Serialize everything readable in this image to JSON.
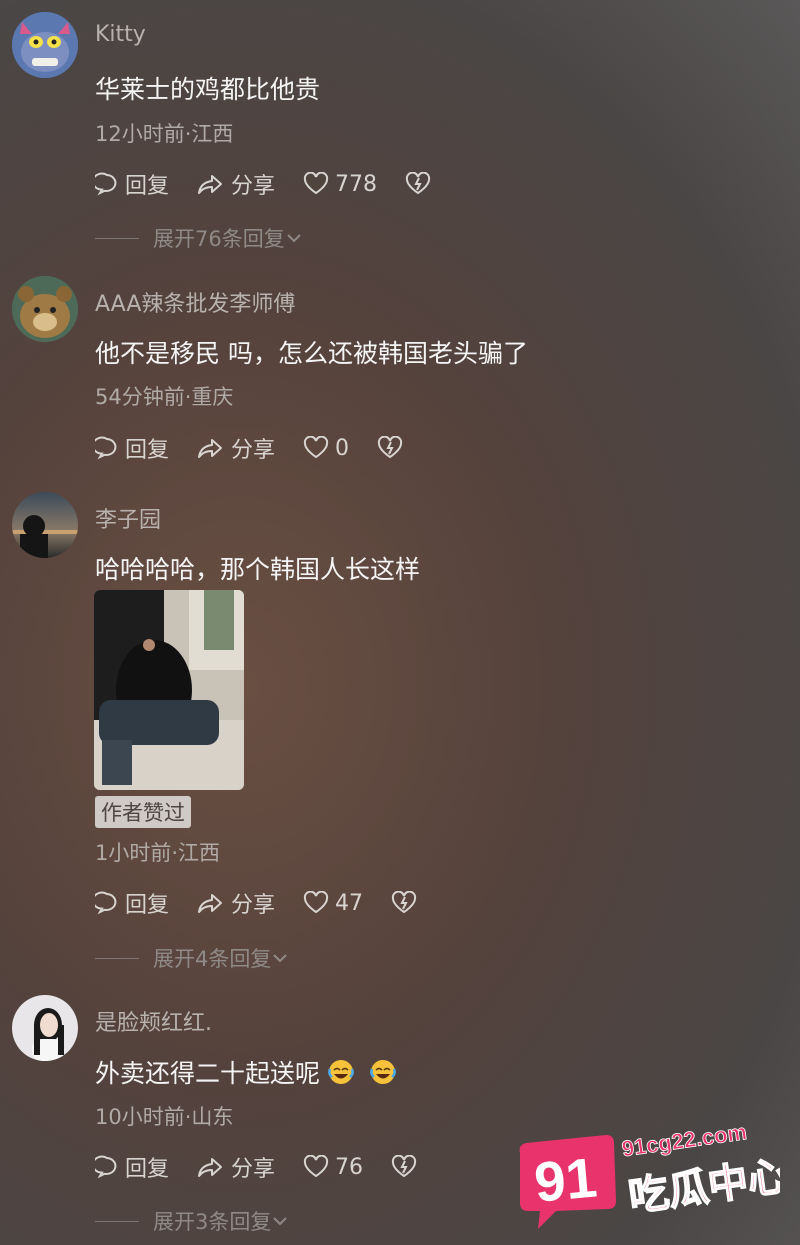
{
  "comments": [
    {
      "user": "Kitty",
      "text": "华莱士的鸡都比他贵",
      "meta": "12小时前·江西",
      "reply_label": "回复",
      "share_label": "分享",
      "likes": "778",
      "expand": "展开76条回复"
    },
    {
      "user": "AAA辣条批发李师傅",
      "text": "他不是移民 吗，怎么还被韩国老头骗了",
      "meta": "54分钟前·重庆",
      "reply_label": "回复",
      "share_label": "分享",
      "likes": "0"
    },
    {
      "user": "李子园",
      "text": "哈哈哈哈，那个韩国人长这样",
      "tag": "作者赞过",
      "meta": "1小时前·江西",
      "reply_label": "回复",
      "share_label": "分享",
      "likes": "47",
      "expand": "展开4条回复"
    },
    {
      "user": "是脸颊红红.",
      "text": "外卖还得二十起送呢",
      "meta": "10小时前·山东",
      "reply_label": "回复",
      "share_label": "分享",
      "likes": "76",
      "expand": "展开3条回复"
    }
  ],
  "watermark": {
    "number": "91",
    "domain": "91cg22.com",
    "slogan": "吃瓜中心",
    "color": "#e8336d"
  },
  "icons": [
    "comment-icon",
    "share-icon",
    "heart-icon",
    "dislike-heart-icon",
    "chevron-down-icon",
    "laugh-cry-emoji"
  ]
}
